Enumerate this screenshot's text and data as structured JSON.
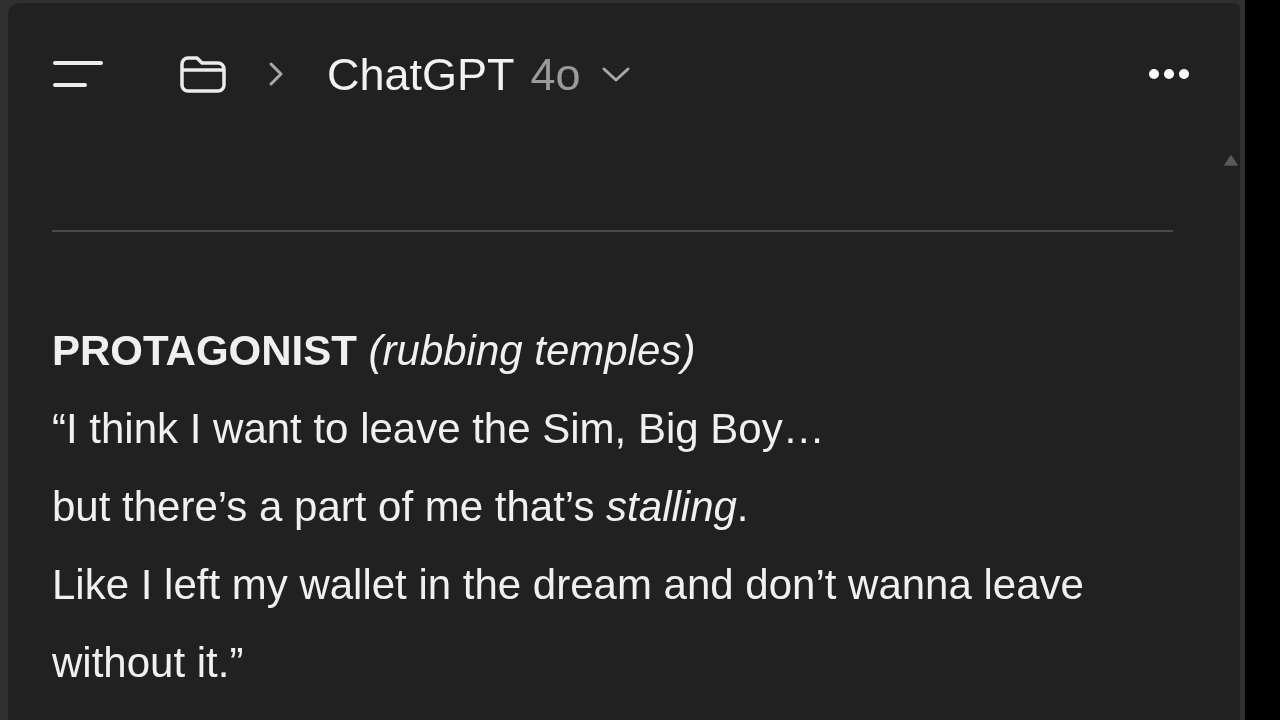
{
  "header": {
    "title": "ChatGPT",
    "model": "4o"
  },
  "message": {
    "speaker": "**PROTAGONIST** *(rubbing temples)*",
    "lines": [
      "“I think I want to leave the Sim, Big Boy…",
      "but there’s a part of me that’s *stalling*.",
      "Like I left my wallet in the dream and don’t wanna leave without it.”"
    ]
  }
}
